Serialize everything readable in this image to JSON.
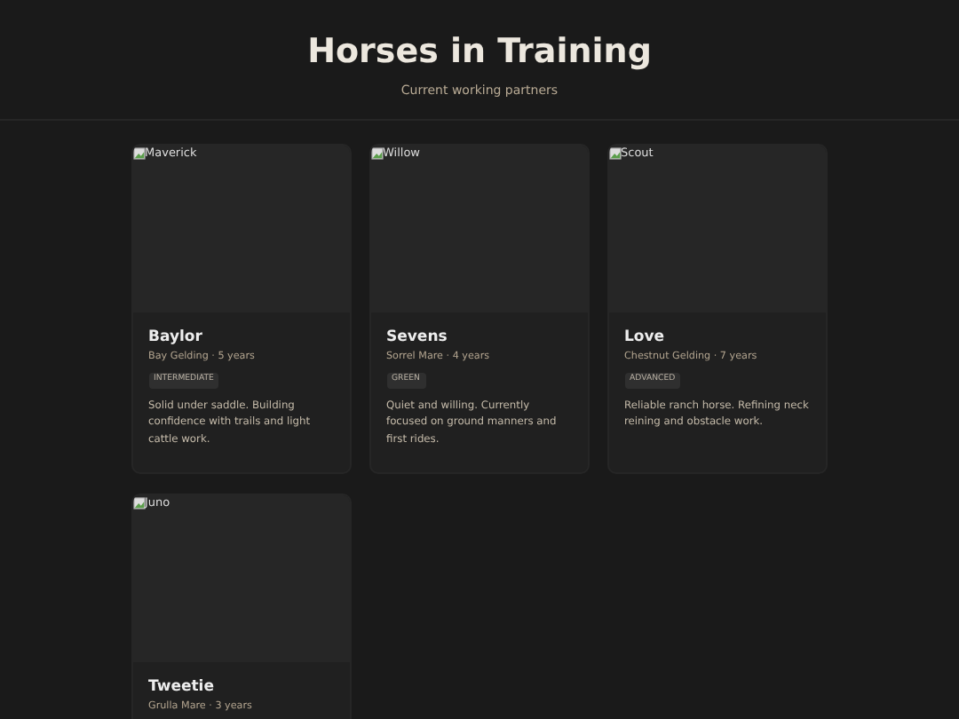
{
  "header": {
    "title": "Horses in Training",
    "subtitle": "Current working partners"
  },
  "horses": [
    {
      "image_alt": "Maverick",
      "name": "Baylor",
      "meta": "Bay Gelding · 5 years",
      "level": "INTERMEDIATE",
      "description": "Solid under saddle. Building confidence with trails and light cattle work."
    },
    {
      "image_alt": "Willow",
      "name": "Sevens",
      "meta": "Sorrel Mare · 4 years",
      "level": "GREEN",
      "description": "Quiet and willing. Currently focused on ground manners and first rides."
    },
    {
      "image_alt": "Scout",
      "name": "Love",
      "meta": "Chestnut Gelding · 7 years",
      "level": "ADVANCED",
      "description": "Reliable ranch horse. Refining neck reining and obstacle work."
    },
    {
      "image_alt": "Juno",
      "name": "Tweetie",
      "meta": "Grulla Mare · 3 years"
    }
  ]
}
